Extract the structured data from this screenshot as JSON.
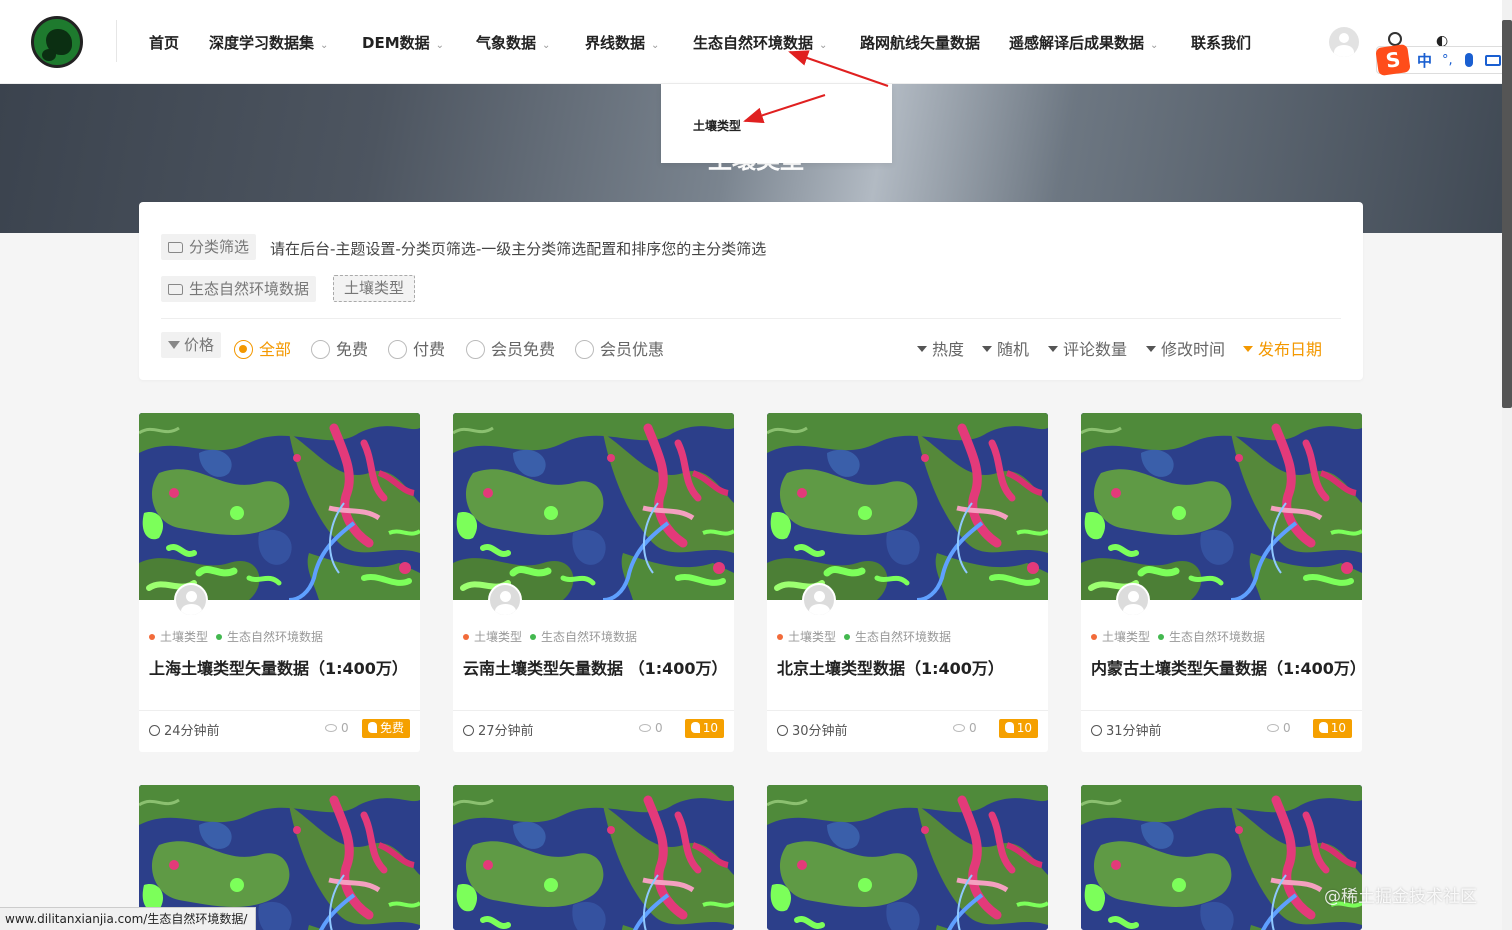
{
  "nav": {
    "items": [
      {
        "label": "首页",
        "has_dropdown": false
      },
      {
        "label": "深度学习数据集",
        "has_dropdown": true
      },
      {
        "label": "DEM数据",
        "has_dropdown": true
      },
      {
        "label": "气象数据",
        "has_dropdown": true
      },
      {
        "label": "界线数据",
        "has_dropdown": true
      },
      {
        "label": "生态自然环境数据",
        "has_dropdown": true
      },
      {
        "label": "路网航线矢量数据",
        "has_dropdown": false
      },
      {
        "label": "遥感解译后成果数据",
        "has_dropdown": true
      },
      {
        "label": "联系我们",
        "has_dropdown": false
      }
    ],
    "chevron": "⌄"
  },
  "ime": {
    "logo": "S",
    "mode": "中",
    "punct": "°,"
  },
  "dropdown": {
    "item": "土壤类型"
  },
  "banner": {
    "title": "土壤类型"
  },
  "filter": {
    "category_label": "分类筛选",
    "note": "请在后台-主题设置-分类页筛选-一级主分类筛选配置和排序您的主分类筛选",
    "parent_category": "生态自然环境数据",
    "active_category": "土壤类型",
    "price_label": "价格",
    "price_options": [
      "全部",
      "免费",
      "付费",
      "会员免费",
      "会员优惠"
    ],
    "price_selected": "全部",
    "sort_options": [
      "热度",
      "随机",
      "评论数量",
      "修改时间",
      "发布日期"
    ],
    "sort_selected": "发布日期"
  },
  "cards": [
    {
      "cat1": "土壤类型",
      "cat2": "生态自然环境数据",
      "title": "上海土壤类型矢量数据（1:400万）",
      "time": "24分钟前",
      "views": "0",
      "price": "免费"
    },
    {
      "cat1": "土壤类型",
      "cat2": "生态自然环境数据",
      "title": "云南土壤类型矢量数据 （1:400万）",
      "time": "27分钟前",
      "views": "0",
      "price": "10"
    },
    {
      "cat1": "土壤类型",
      "cat2": "生态自然环境数据",
      "title": "北京土壤类型数据（1:400万）",
      "time": "30分钟前",
      "views": "0",
      "price": "10"
    },
    {
      "cat1": "土壤类型",
      "cat2": "生态自然环境数据",
      "title": "内蒙古土壤类型矢量数据（1:400万）",
      "time": "31分钟前",
      "views": "0",
      "price": "10"
    }
  ],
  "status_bar": {
    "url": "www.dilitanxianjia.com/生态自然环境数据/"
  },
  "watermark": "@稀土掘金技术社区",
  "colors": {
    "accent": "#f39800",
    "price_badge": "#f5a000",
    "annotation_arrow": "#e02020"
  }
}
